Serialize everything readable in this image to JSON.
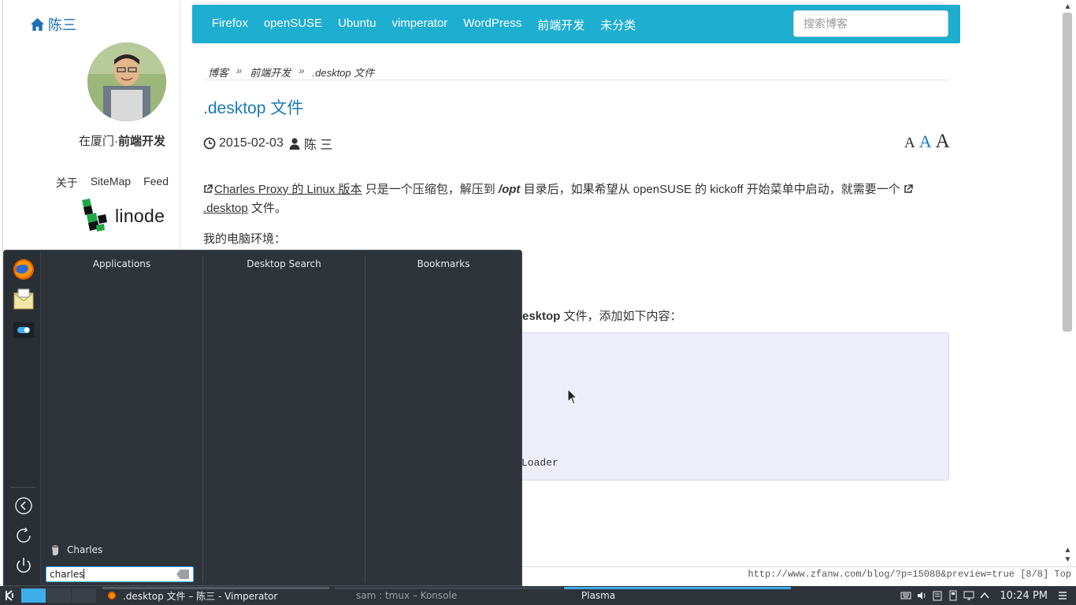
{
  "sidebar": {
    "home_label": "陈三",
    "tagline_prefix": "在厦门·",
    "tagline_bold": "前端开发",
    "links": [
      "关于",
      "SiteMap",
      "Feed"
    ],
    "sponsor": "linode"
  },
  "nav": {
    "items": [
      "Firefox",
      "openSUSE",
      "Ubuntu",
      "vimperator",
      "WordPress",
      "前端开发",
      "未分类"
    ],
    "search_placeholder": "搜索博客"
  },
  "breadcrumb": {
    "items": [
      "博客",
      "前端开发",
      ".desktop 文件"
    ],
    "separator": "»"
  },
  "post": {
    "title": ".desktop 文件",
    "date": "2015-02-03",
    "author": "陈 三",
    "font_sizes": [
      "A",
      "A",
      "A"
    ],
    "link1": "Charles Proxy 的 Linux 版本",
    "text1": " 只是一个压缩包，解压到 ",
    "opt": "/opt",
    "text2": " 目录后，如果希望从 openSUSE 的 kickoff 开始菜单中启动，就需要一个 ",
    "link2": ".desktop",
    "text3": " 文件。",
    "env_label": "我的电脑环境：",
    "partial_bold": "esktop",
    "partial_rest": " 文件，添加如下内容：",
    "code_tail": "Loader"
  },
  "status": {
    "url": "http://www.zfanw.com/blog/?p=15088&preview=true [8/8] Top"
  },
  "kickoff": {
    "columns": [
      "Applications",
      "Desktop Search",
      "Bookmarks"
    ],
    "result": "Charles",
    "search_value": "charles",
    "favorites": [
      "firefox-icon",
      "kmail-icon",
      "system-settings-icon"
    ],
    "system_actions": [
      "back-icon",
      "refresh-icon",
      "power-icon"
    ]
  },
  "taskbar": {
    "tasks": [
      ".desktop 文件 – 陈三 - Vimperator",
      "sam : tmux – Konsole",
      "Plasma"
    ],
    "clock": "10:24 PM",
    "colors": {
      "accent": "#3daee9",
      "panel": "#2f343b",
      "nav": "#1eaed0"
    }
  }
}
